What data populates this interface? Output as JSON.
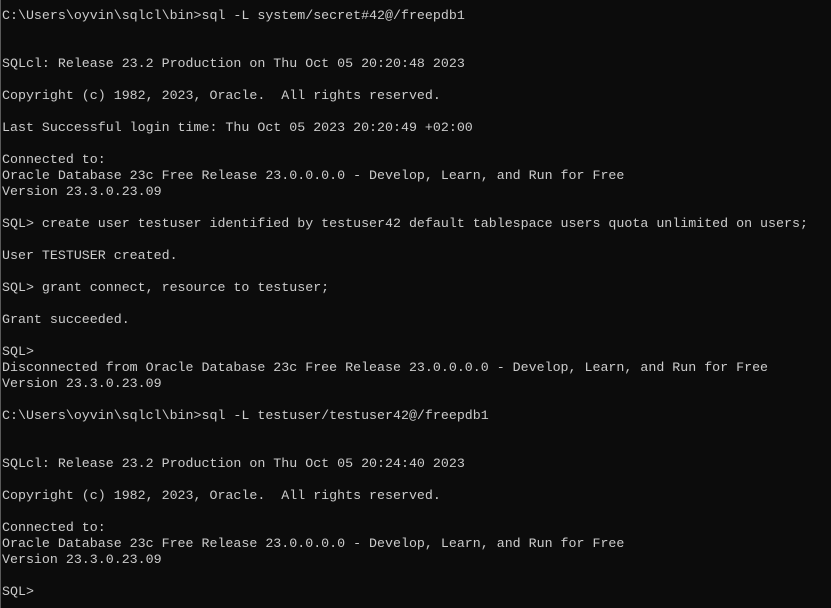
{
  "window": {
    "background": "#0c0c0c",
    "foreground": "#cccccc"
  },
  "terminal": {
    "lines": [
      "C:\\Users\\oyvin\\sqlcl\\bin>sql -L system/secret#42@/freepdb1",
      "",
      "",
      "SQLcl: Release 23.2 Production on Thu Oct 05 20:20:48 2023",
      "",
      "Copyright (c) 1982, 2023, Oracle.  All rights reserved.",
      "",
      "Last Successful login time: Thu Oct 05 2023 20:20:49 +02:00",
      "",
      "Connected to:",
      "Oracle Database 23c Free Release 23.0.0.0.0 - Develop, Learn, and Run for Free",
      "Version 23.3.0.23.09",
      "",
      "SQL> create user testuser identified by testuser42 default tablespace users quota unlimited on users;",
      "",
      "User TESTUSER created.",
      "",
      "SQL> grant connect, resource to testuser;",
      "",
      "Grant succeeded.",
      "",
      "SQL>",
      "Disconnected from Oracle Database 23c Free Release 23.0.0.0.0 - Develop, Learn, and Run for Free",
      "Version 23.3.0.23.09",
      "",
      "C:\\Users\\oyvin\\sqlcl\\bin>sql -L testuser/testuser42@/freepdb1",
      "",
      "",
      "SQLcl: Release 23.2 Production on Thu Oct 05 20:24:40 2023",
      "",
      "Copyright (c) 1982, 2023, Oracle.  All rights reserved.",
      "",
      "Connected to:",
      "Oracle Database 23c Free Release 23.0.0.0.0 - Develop, Learn, and Run for Free",
      "Version 23.3.0.23.09",
      "",
      "SQL>"
    ]
  }
}
